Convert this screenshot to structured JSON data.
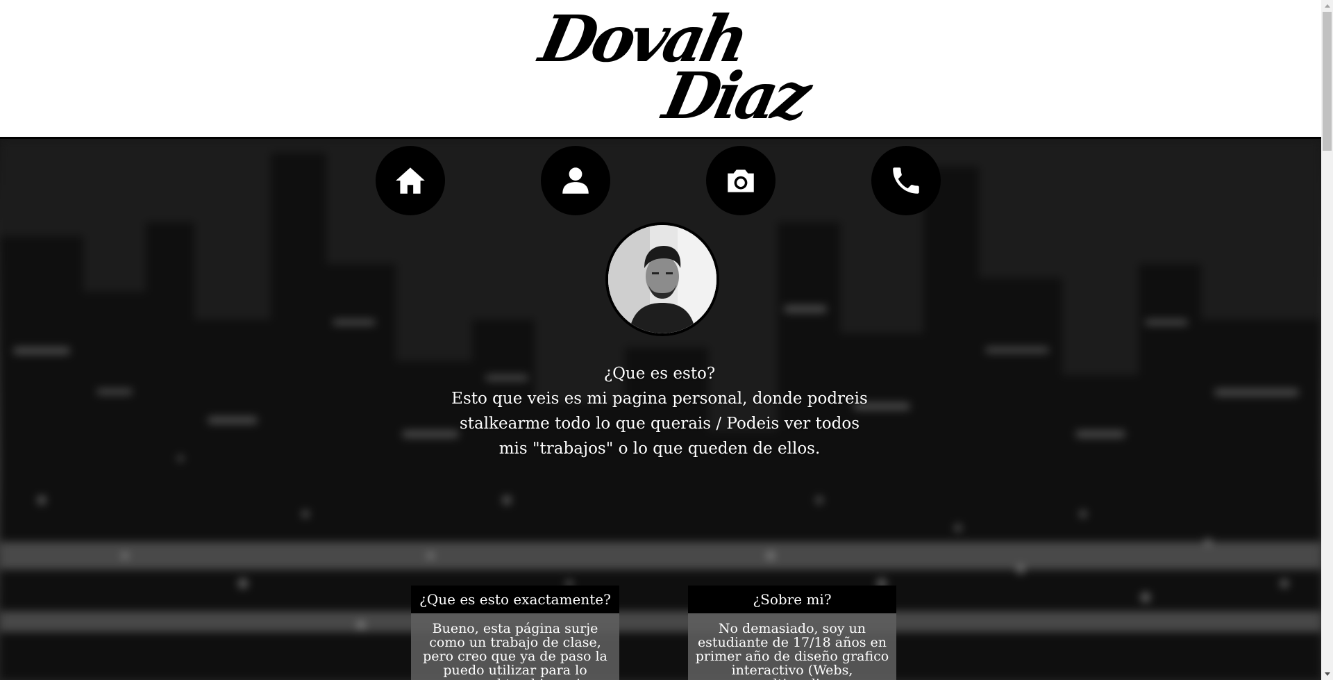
{
  "header": {
    "logo_line1": "Dovah",
    "logo_line2": "Diaz"
  },
  "nav": {
    "items": [
      {
        "icon": "home-icon",
        "label": "Inicio"
      },
      {
        "icon": "user-icon",
        "label": "Perfil"
      },
      {
        "icon": "camera-icon",
        "label": "Fotos"
      },
      {
        "icon": "phone-icon",
        "label": "Contacto"
      }
    ]
  },
  "intro": {
    "title": "¿Que es esto?",
    "text": "Esto que veis es mi pagina personal, donde podreis stalkearme todo lo que querais / Podeis ver todos mis \"trabajos\" o lo que queden de ellos."
  },
  "cards": [
    {
      "title": "¿Que es esto exactamente?",
      "body": "Bueno, esta página surje como un trabajo de clase, pero creo que ya de paso la puedo utilizar para lo personal tambien e ir"
    },
    {
      "title": "¿Sobre mi?",
      "body": "No demasiado, soy un estudiante de 17/18 años en primer año de diseño grafico interactivo (Webs, multimedia,"
    }
  ],
  "colors": {
    "nav_bg": "#000000",
    "header_bg": "#ffffff",
    "text": "#ffffff"
  }
}
